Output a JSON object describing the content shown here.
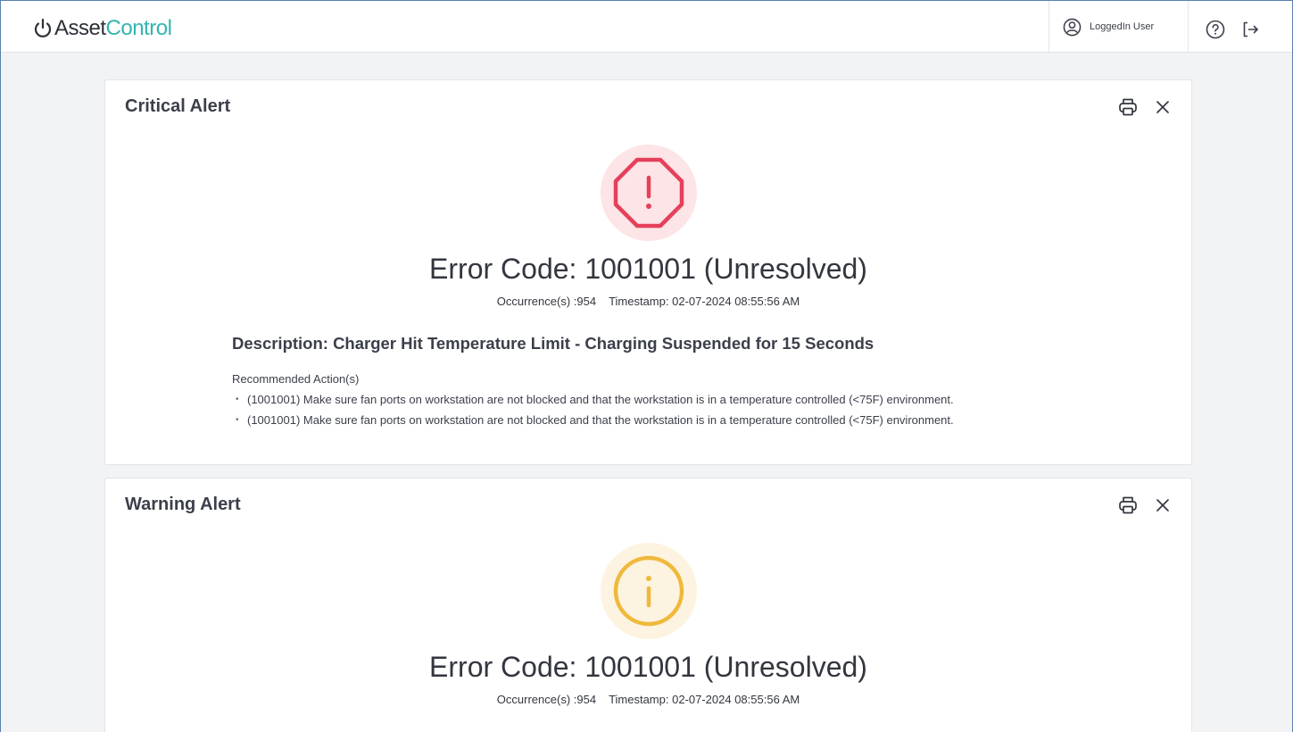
{
  "header": {
    "logo_part1": "Asset",
    "logo_part2": "Control",
    "user_name": "LoggedIn User",
    "icons": [
      "power-icon",
      "user-circle-icon",
      "help-icon",
      "logout-icon"
    ]
  },
  "alerts": [
    {
      "title": "Critical Alert",
      "icon": "stop-exclamation-icon",
      "accent": "#e5405a",
      "error_code": "Error Code: 1001001 (Unresolved)",
      "occurrences": "Occurrence(s) :954",
      "timestamp": "Timestamp: 02-07-2024 08:55:56 AM",
      "description": "Description: Charger Hit Temperature Limit - Charging Suspended for 15 Seconds",
      "recommended_label": "Recommended Action(s)",
      "actions": [
        "(1001001) Make sure fan ports on workstation are not blocked and that the workstation is in a temperature controlled (<75F) environment.",
        "(1001001) Make sure fan ports on workstation are not blocked and that the workstation is in a temperature controlled (<75F) environment."
      ]
    },
    {
      "title": "Warning Alert",
      "icon": "info-circle-icon",
      "accent": "#f0b93c",
      "error_code": "Error Code: 1001001 (Unresolved)",
      "occurrences": "Occurrence(s) :954",
      "timestamp": "Timestamp: 02-07-2024 08:55:56 AM"
    }
  ]
}
